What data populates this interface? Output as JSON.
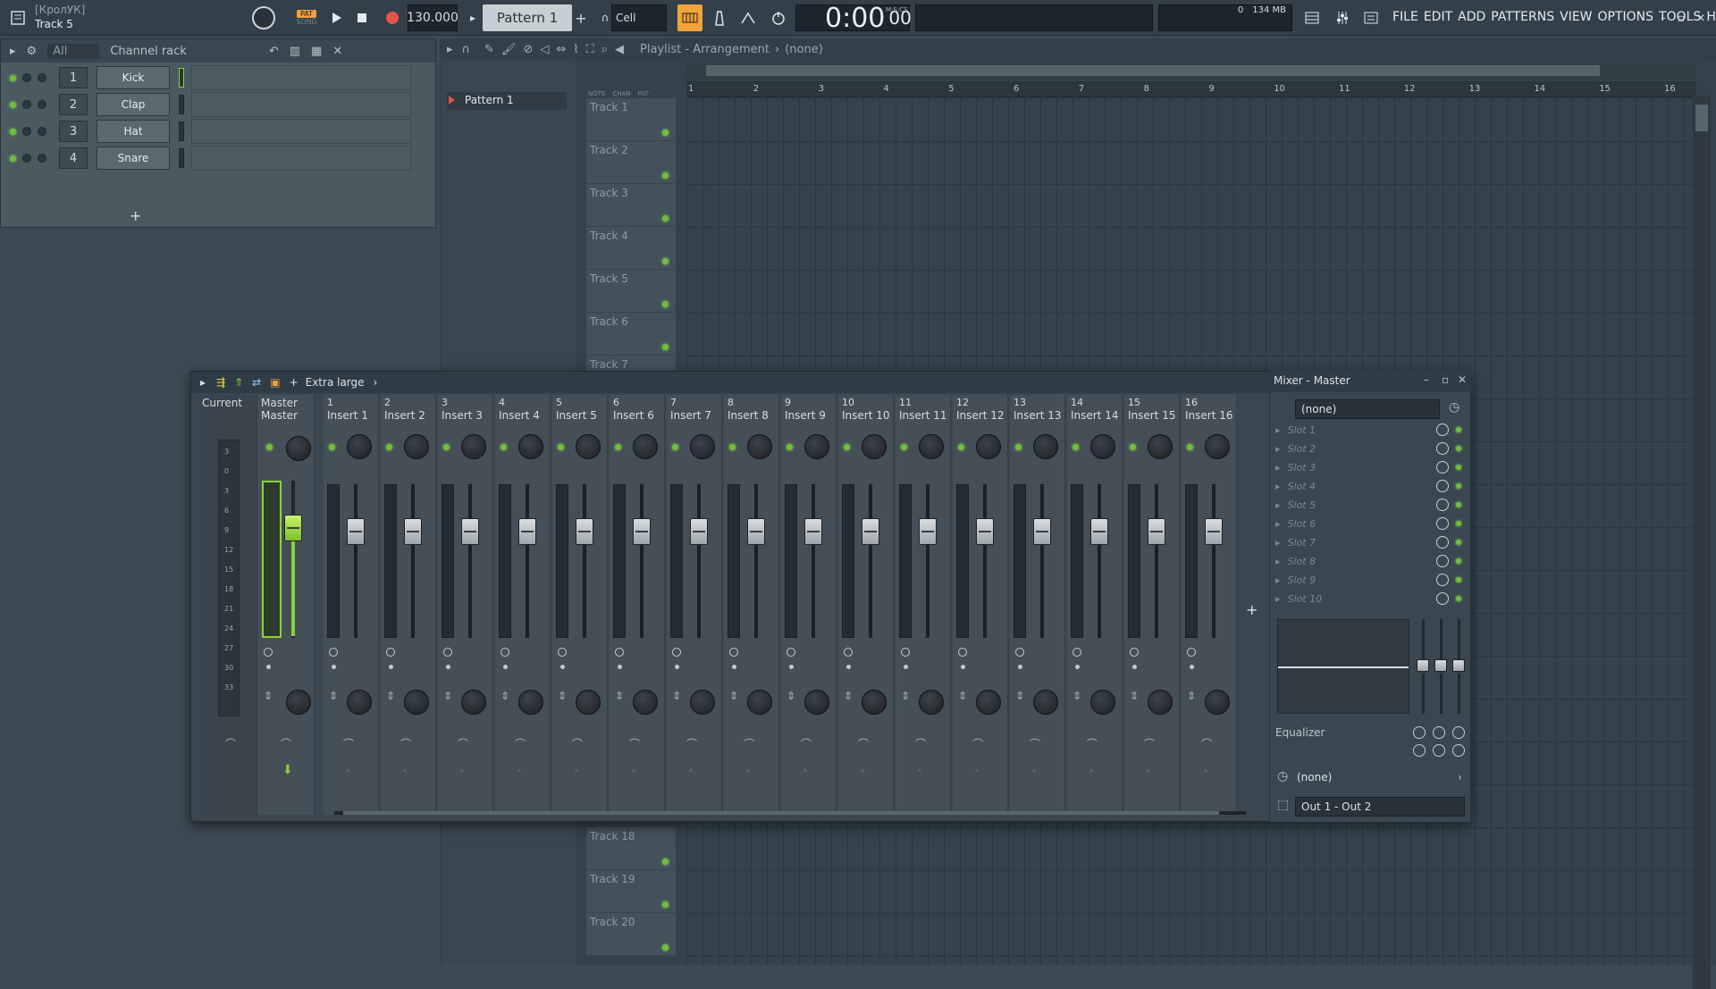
{
  "titlebar": {
    "project": "[КролУК]",
    "hint": "Track 5"
  },
  "transport": {
    "pat": "PAT",
    "song": "SONG",
    "tempo": "130.000",
    "pattern": "Pattern 1",
    "snap": "Cell",
    "time": "0:00",
    "time_small": "00",
    "time_unit": "M:S:CS",
    "mem": "134 MB",
    "cpu": "0",
    "voices": "0"
  },
  "menu": [
    "FILE",
    "EDIT",
    "ADD",
    "PATTERNS",
    "VIEW",
    "OPTIONS",
    "TOOLS",
    "HELP"
  ],
  "channel_rack": {
    "filter": "All",
    "title": "Channel rack",
    "add": "+",
    "channels": [
      {
        "num": "1",
        "name": "Kick"
      },
      {
        "num": "2",
        "name": "Clap"
      },
      {
        "num": "3",
        "name": "Hat"
      },
      {
        "num": "4",
        "name": "Snare"
      }
    ]
  },
  "playlist": {
    "title": "Playlist - Arrangement",
    "target": "(none)",
    "pattern_item": "Pattern 1",
    "ruler": [
      "1",
      "2",
      "3",
      "4",
      "5",
      "6",
      "7",
      "8",
      "9",
      "10",
      "11",
      "12",
      "13",
      "14",
      "15",
      "16"
    ],
    "tracks_top": [
      "Track 1",
      "Track 2",
      "Track 3",
      "Track 4",
      "Track 5",
      "Track 6",
      "Track 7"
    ],
    "tracks_bottom": [
      "Track 18",
      "Track 19",
      "Track 20"
    ],
    "mode_labels": [
      "NOTE",
      "CHAN",
      "PAT"
    ]
  },
  "mixer": {
    "size": "Extra large",
    "title": "Mixer - Master",
    "current": "Current",
    "master_num": "Master",
    "master_name": "Master",
    "inserts": [
      {
        "n": "1",
        "name": "Insert 1"
      },
      {
        "n": "2",
        "name": "Insert 2"
      },
      {
        "n": "3",
        "name": "Insert 3"
      },
      {
        "n": "4",
        "name": "Insert 4"
      },
      {
        "n": "5",
        "name": "Insert 5"
      },
      {
        "n": "6",
        "name": "Insert 6"
      },
      {
        "n": "7",
        "name": "Insert 7"
      },
      {
        "n": "8",
        "name": "Insert 8"
      },
      {
        "n": "9",
        "name": "Insert 9"
      },
      {
        "n": "10",
        "name": "Insert 10"
      },
      {
        "n": "11",
        "name": "Insert 11"
      },
      {
        "n": "12",
        "name": "Insert 12"
      },
      {
        "n": "13",
        "name": "Insert 13"
      },
      {
        "n": "14",
        "name": "Insert 14"
      },
      {
        "n": "15",
        "name": "Insert 15"
      },
      {
        "n": "16",
        "name": "Insert 16"
      }
    ],
    "scale": [
      "3",
      "0",
      "3",
      "6",
      "9",
      "12",
      "15",
      "18",
      "21",
      "24",
      "27",
      "30",
      "33"
    ],
    "input": "(none)",
    "slots": [
      "Slot 1",
      "Slot 2",
      "Slot 3",
      "Slot 4",
      "Slot 5",
      "Slot 6",
      "Slot 7",
      "Slot 8",
      "Slot 9",
      "Slot 10"
    ],
    "eq": "Equalizer",
    "sidechain": "(none)",
    "output": "Out 1 - Out 2"
  },
  "colors": {
    "accent_green": "#8ed13b",
    "bg": "#3d4a53",
    "record": "#e0544a",
    "transport_orange": "#f2a33a"
  }
}
